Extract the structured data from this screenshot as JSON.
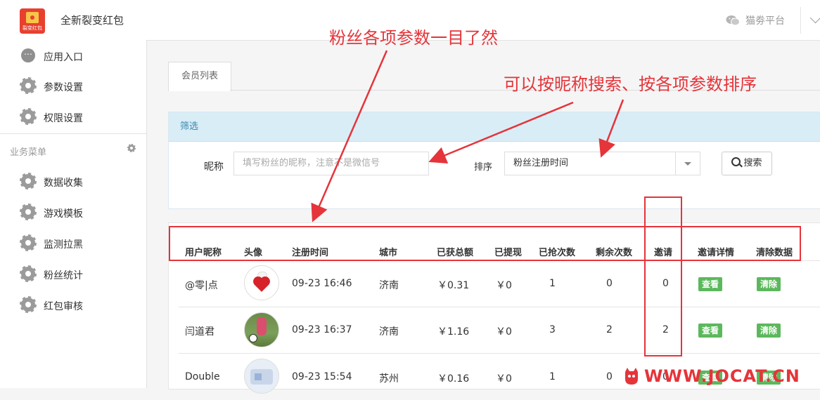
{
  "header": {
    "logo_text": "裂变红包",
    "app_title": "全新裂变红包",
    "platform_label": "猫劵平台"
  },
  "sidebar": {
    "top_items": [
      {
        "label": "应用入口",
        "icon": "chat-icon"
      },
      {
        "label": "参数设置",
        "icon": "gear-icon"
      },
      {
        "label": "权限设置",
        "icon": "gear-icon"
      }
    ],
    "section_label": "业务菜单",
    "business_items": [
      {
        "label": "数据收集",
        "icon": "gear-icon"
      },
      {
        "label": "游戏模板",
        "icon": "gear-icon"
      },
      {
        "label": "监测拉黑",
        "icon": "gear-icon"
      },
      {
        "label": "粉丝统计",
        "icon": "gear-icon"
      },
      {
        "label": "红包审核",
        "icon": "gear-icon"
      }
    ]
  },
  "main": {
    "tab_label": "会员列表",
    "filter": {
      "title": "筛选",
      "nickname_label": "昵称",
      "nickname_placeholder": "填写粉丝的昵称，注意不是微信号",
      "sort_label": "排序",
      "sort_value": "粉丝注册时间",
      "search_button": "搜索"
    },
    "table": {
      "headers": [
        "用户昵称",
        "头像",
        "注册时间",
        "城市",
        "已获总额",
        "已提现",
        "已抢次数",
        "剩余次数",
        "邀请",
        "邀请详情",
        "清除数据"
      ],
      "view_label": "查看",
      "clear_label": "清除",
      "rows": [
        {
          "nickname": "@零|点",
          "reg_time": "09-23 16:46",
          "city": "济南",
          "total": "￥0.31",
          "withdrawn": "￥0",
          "grabbed": "1",
          "remaining": "0",
          "invites": "0"
        },
        {
          "nickname": "闫道君",
          "reg_time": "09-23 16:37",
          "city": "济南",
          "total": "￥1.16",
          "withdrawn": "￥0",
          "grabbed": "3",
          "remaining": "2",
          "invites": "2"
        },
        {
          "nickname": "Double",
          "reg_time": "09-23 15:54",
          "city": "苏州",
          "total": "￥0.16",
          "withdrawn": "￥0",
          "grabbed": "1",
          "remaining": "0",
          "invites": "0"
        }
      ]
    }
  },
  "annotations": {
    "note1": "粉丝各项参数一目了然",
    "note2": "可以按昵称搜索、按各项参数排序",
    "color": "#e5343a"
  },
  "watermark": "WWW.JOCAT.CN"
}
